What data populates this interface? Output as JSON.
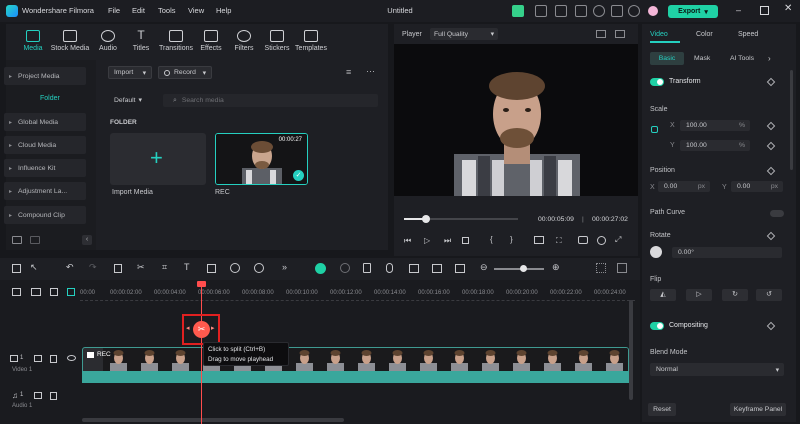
{
  "titlebar": {
    "app_name": "Wondershare Filmora",
    "menus": [
      "File",
      "Edit",
      "Tools",
      "View",
      "Help"
    ],
    "doc_title": "Untitled",
    "export_label": "Export"
  },
  "media_tabs": [
    {
      "label": "Media",
      "icon": "media-icon"
    },
    {
      "label": "Stock Media",
      "icon": "stock-media-icon"
    },
    {
      "label": "Audio",
      "icon": "audio-icon"
    },
    {
      "label": "Titles",
      "icon": "titles-icon"
    },
    {
      "label": "Transitions",
      "icon": "transitions-icon"
    },
    {
      "label": "Effects",
      "icon": "effects-icon"
    },
    {
      "label": "Filters",
      "icon": "filters-icon"
    },
    {
      "label": "Stickers",
      "icon": "stickers-icon"
    },
    {
      "label": "Templates",
      "icon": "templates-icon"
    }
  ],
  "sidebar": {
    "project_media": "Project Media",
    "folder": "Folder",
    "items": [
      "Global Media",
      "Cloud Media",
      "Influence Kit",
      "Adjustment La...",
      "Compound Clip"
    ]
  },
  "media_toolbar": {
    "import_label": "Import",
    "record_label": "Record",
    "sort_label": "Default",
    "search_placeholder": "Search media",
    "folder_heading": "FOLDER"
  },
  "media_items": [
    {
      "label": "Import Media"
    },
    {
      "label": "REC",
      "duration": "00:00:27"
    }
  ],
  "player": {
    "label": "Player",
    "quality": "Full Quality",
    "current_time": "00:00:05:09",
    "total_time": "00:00:27:02",
    "progress": 0.19
  },
  "props": {
    "tabs": [
      "Video",
      "Color",
      "Speed"
    ],
    "subtabs": [
      "Basic",
      "Mask",
      "AI Tools"
    ],
    "transform": "Transform",
    "scale": "Scale",
    "scale_x_label": "X",
    "scale_x": "100.00",
    "scale_y_label": "Y",
    "scale_y": "100.00",
    "percent": "%",
    "position": "Position",
    "pos_x_label": "X",
    "pos_x": "0.00",
    "pos_y_label": "Y",
    "pos_y": "0.00",
    "px": "px",
    "path_curve": "Path Curve",
    "rotate": "Rotate",
    "rotate_value": "0.00°",
    "flip": "Flip",
    "compositing": "Compositing",
    "blend_mode": "Blend Mode",
    "blend_value": "Normal",
    "reset": "Reset",
    "keyframe_panel": "Keyframe Panel"
  },
  "timeline": {
    "ticks": [
      "00:00",
      "00:00:02:00",
      "00:00:04:00",
      "00:00:06:00",
      "00:00:08:00",
      "00:00:10:00",
      "00:00:12:00",
      "00:00:14:00",
      "00:00:16:00",
      "00:00:18:00",
      "00:00:20:00",
      "00:00:22:00",
      "00:00:24:00"
    ],
    "clip_label": "REC",
    "tooltip_line1": "Click to split (Ctrl+B)",
    "tooltip_line2": "Drag to move playhead",
    "video_track": "Video 1",
    "audio_track": "Audio 1",
    "video_track_num": "1",
    "audio_track_num": "1"
  },
  "colors": {
    "accent": "#1fd1a5",
    "playhead": "#ff4d4d",
    "highlight_box": "#e02020"
  }
}
